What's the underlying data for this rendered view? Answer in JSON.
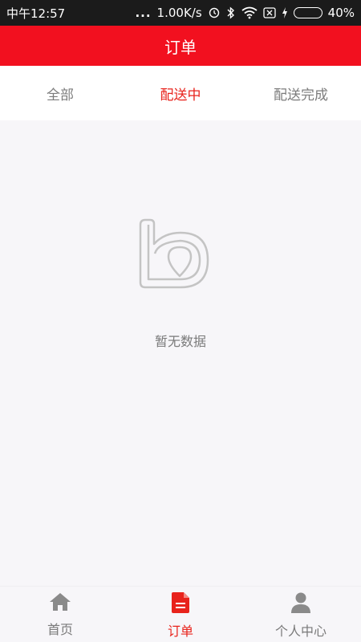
{
  "status_bar": {
    "time": "中午12:57",
    "dots": "...",
    "speed": "1.00K/s",
    "battery_percent": "40%",
    "battery_level": 0.4,
    "icons": [
      "alarm-icon",
      "bluetooth-icon",
      "wifi-icon",
      "sim-x-icon",
      "charging-icon",
      "battery-icon"
    ]
  },
  "header": {
    "title": "订单"
  },
  "tabs": [
    {
      "label": "全部",
      "active": false
    },
    {
      "label": "配送中",
      "active": true
    },
    {
      "label": "配送完成",
      "active": false
    }
  ],
  "empty_state": {
    "message": "暂无数据",
    "icon": "brand-b-logo-icon"
  },
  "bottom_nav": [
    {
      "label": "首页",
      "icon": "home-icon",
      "active": false
    },
    {
      "label": "订单",
      "icon": "order-document-icon",
      "active": true
    },
    {
      "label": "个人中心",
      "icon": "person-icon",
      "active": false
    }
  ],
  "colors": {
    "accent": "#f2101f",
    "active_text": "#e8231c",
    "inactive_text": "#7c7c7c",
    "inactive_icon": "#8a8a8a",
    "background": "#f7f6f9"
  }
}
